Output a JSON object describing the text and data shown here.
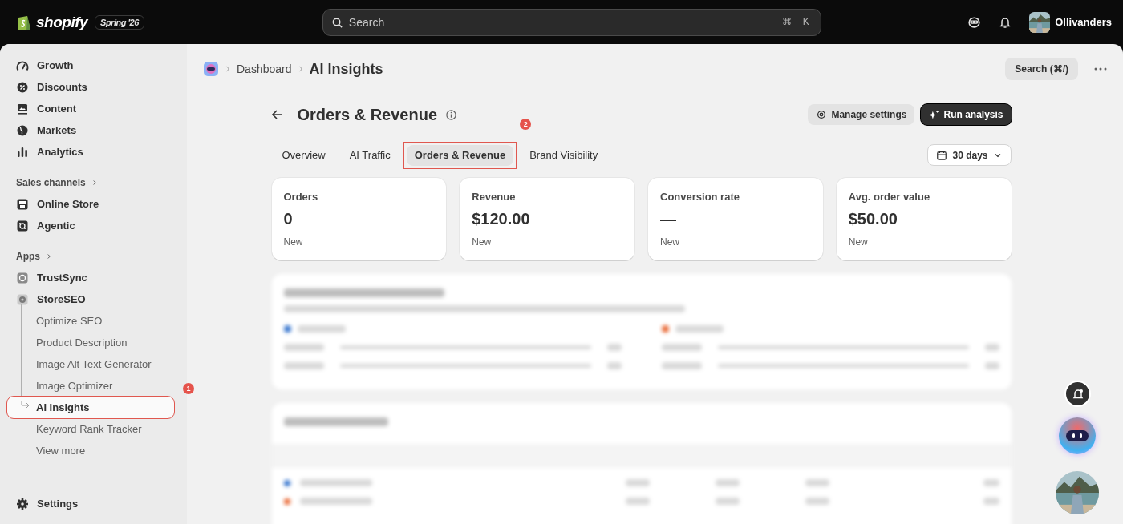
{
  "topbar": {
    "logo": "shopify",
    "edition": "Spring '26",
    "search": {
      "placeholder": "Search",
      "keys": [
        "⌘",
        "K"
      ]
    },
    "store": "Ollivanders"
  },
  "sidebar": {
    "items": [
      {
        "kind": "item",
        "label": "Growth"
      },
      {
        "kind": "item",
        "label": "Discounts"
      },
      {
        "kind": "item",
        "label": "Content"
      },
      {
        "kind": "item",
        "label": "Markets"
      },
      {
        "kind": "item",
        "label": "Analytics"
      },
      {
        "kind": "section",
        "label": "Sales channels"
      },
      {
        "kind": "item",
        "label": "Online Store"
      },
      {
        "kind": "item",
        "label": "Agentic"
      },
      {
        "kind": "section",
        "label": "Apps"
      },
      {
        "kind": "item",
        "label": "TrustSync"
      },
      {
        "kind": "item",
        "label": "StoreSEO",
        "children": [
          {
            "label": "Optimize SEO",
            "selected": false
          },
          {
            "label": "Product Description",
            "selected": false
          },
          {
            "label": "Image Alt Text Generator",
            "selected": false
          },
          {
            "label": "Image Optimizer",
            "selected": false
          },
          {
            "label": "AI Insights",
            "selected": true,
            "annotation": "1"
          },
          {
            "label": "Keyword Rank Tracker",
            "selected": false
          },
          {
            "label": "View more",
            "selected": false
          }
        ]
      }
    ],
    "settings": "Settings"
  },
  "breadcrumb": [
    "Dashboard",
    "AI Insights"
  ],
  "header_search": "Search (⌘/)",
  "page": {
    "title": "Orders & Revenue",
    "buttons": [
      {
        "label": "Manage settings",
        "kind": "secondary"
      },
      {
        "label": "Run analysis",
        "kind": "primary"
      }
    ],
    "tabs": [
      {
        "label": "Overview",
        "selected": false
      },
      {
        "label": "AI Traffic",
        "selected": false
      },
      {
        "label": "Orders & Revenue",
        "selected": true,
        "annotation": "2"
      },
      {
        "label": "Brand Visibility",
        "selected": false
      }
    ],
    "date_range": "30 days",
    "metrics": [
      {
        "label": "Orders",
        "value": "0",
        "note": "New"
      },
      {
        "label": "Revenue",
        "value": "$120.00",
        "note": "New"
      },
      {
        "label": "Conversion rate",
        "value": "—",
        "note": "New"
      },
      {
        "label": "Avg. order value",
        "value": "$50.00",
        "note": "New"
      }
    ]
  }
}
